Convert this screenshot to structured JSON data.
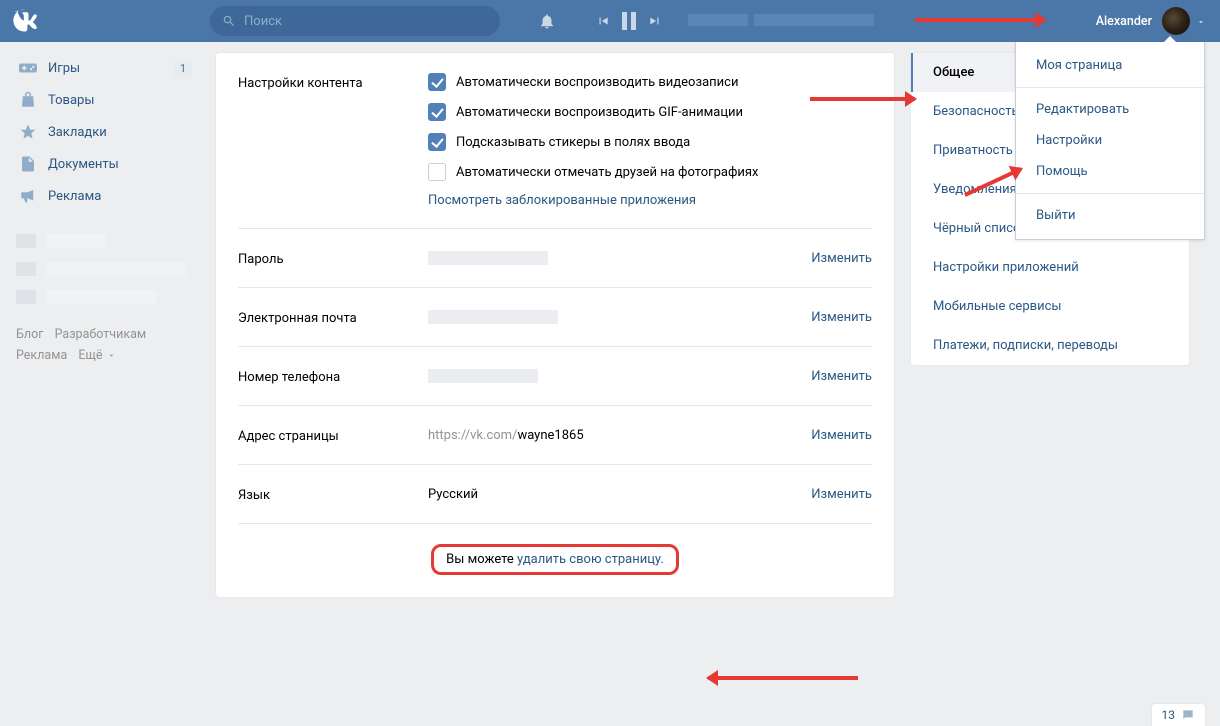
{
  "header": {
    "search_placeholder": "Поиск",
    "user_name": "Alexander"
  },
  "dropdown": {
    "my_page": "Моя страница",
    "edit": "Редактировать",
    "settings": "Настройки",
    "help": "Помощь",
    "logout": "Выйти"
  },
  "leftnav": {
    "games": {
      "label": "Игры",
      "badge": "1"
    },
    "goods": "Товары",
    "bookmarks": "Закладки",
    "documents": "Документы",
    "ads": "Реклама"
  },
  "footer": {
    "blog": "Блог",
    "devs": "Разработчикам",
    "ads": "Реклама",
    "more": "Ещё"
  },
  "settings": {
    "content": {
      "label": "Настройки контента",
      "autoplay_video": "Автоматически воспроизводить видеозаписи",
      "autoplay_gif": "Автоматически воспроизводить GIF-анимации",
      "suggest_stickers": "Подсказывать стикеры в полях ввода",
      "auto_tag": "Автоматически отмечать друзей на фотографиях",
      "blocked_apps": "Посмотреть заблокированные приложения"
    },
    "password": {
      "label": "Пароль"
    },
    "email": {
      "label": "Электронная почта"
    },
    "phone": {
      "label": "Номер телефона"
    },
    "address": {
      "label": "Адрес страницы",
      "url_prefix": "https://vk.com/",
      "url_id": "wayne1865"
    },
    "language": {
      "label": "Язык",
      "value": "Русский"
    },
    "change": "Изменить",
    "delete_prefix": "Вы можете ",
    "delete_link": "удалить свою страницу."
  },
  "sidenav": {
    "general": "Общее",
    "security": "Безопасность",
    "privacy": "Приватность",
    "notifications": "Уведомления",
    "blacklist": "Чёрный список",
    "apps": "Настройки приложений",
    "mobile": "Мобильные сервисы",
    "payments": "Платежи, подписки, переводы"
  },
  "chat_count": "13"
}
